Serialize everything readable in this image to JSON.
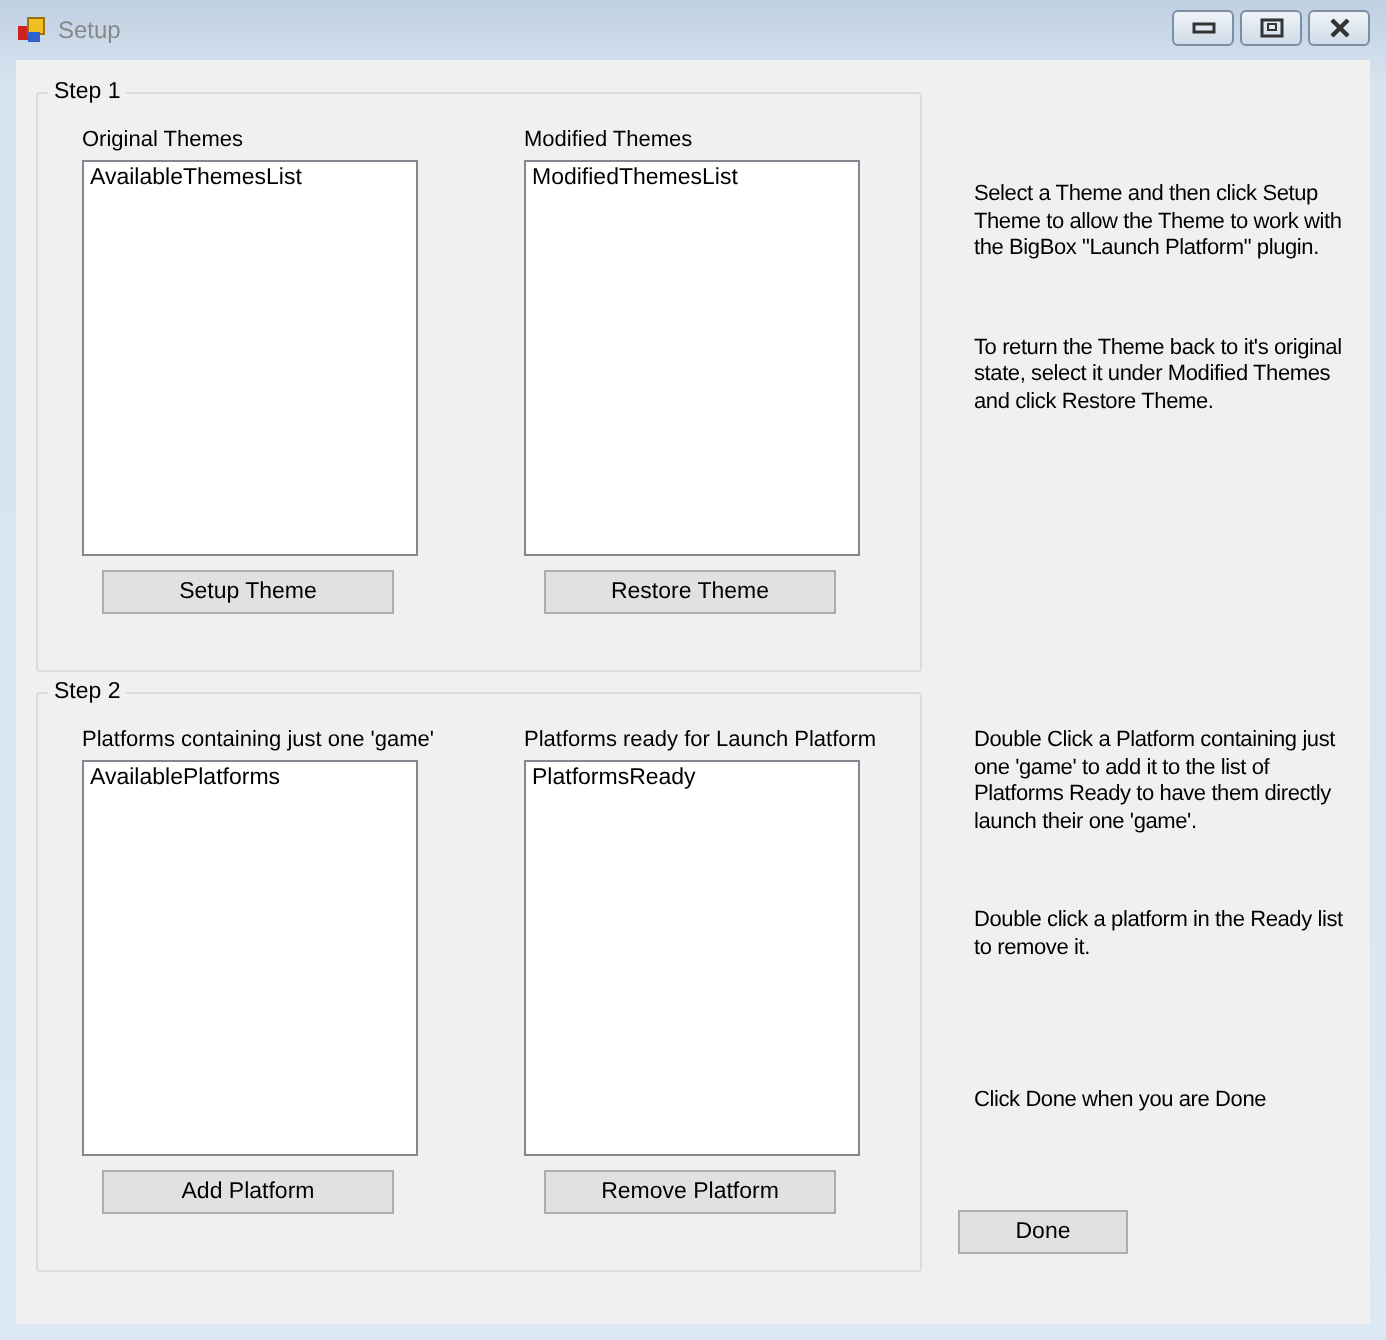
{
  "window": {
    "title": "Setup"
  },
  "groups": [
    {
      "legend": "Step 1",
      "panels": [
        {
          "label": "Original Themes",
          "items": [
            "AvailableThemesList"
          ],
          "button": "Setup Theme"
        },
        {
          "label": "Modified Themes",
          "items": [
            "ModifiedThemesList"
          ],
          "button": "Restore Theme"
        }
      ]
    },
    {
      "legend": "Step 2",
      "panels": [
        {
          "label": "Platforms containing just one 'game'",
          "items": [
            "AvailablePlatforms"
          ],
          "button": "Add Platform"
        },
        {
          "label": "Platforms ready for Launch Platform",
          "items": [
            "PlatformsReady"
          ],
          "button": "Remove Platform"
        }
      ]
    }
  ],
  "notes": [
    "Select a Theme and then click Setup Theme to allow the Theme to work with the BigBox \"Launch Platform\" plugin.",
    "To return the Theme back to it's original state, select it under Modified Themes and click Restore Theme.",
    "Double Click a Platform containing just one 'game' to add it to the list of Platforms Ready to have them directly launch their one 'game'.",
    "Double click a platform in the Ready list to remove it.",
    "Click Done when you are Done"
  ],
  "done_button": "Done"
}
